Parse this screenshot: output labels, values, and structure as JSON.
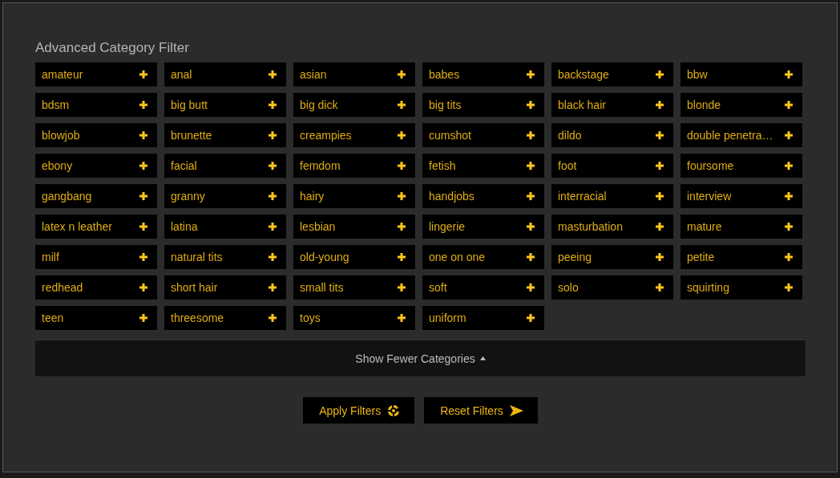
{
  "title": "Advanced Category Filter",
  "categories": [
    "amateur",
    "anal",
    "asian",
    "babes",
    "backstage",
    "bbw",
    "bdsm",
    "big butt",
    "big dick",
    "big tits",
    "black hair",
    "blonde",
    "blowjob",
    "brunette",
    "creampies",
    "cumshot",
    "dildo",
    "double penetra…",
    "ebony",
    "facial",
    "femdom",
    "fetish",
    "foot",
    "foursome",
    "gangbang",
    "granny",
    "hairy",
    "handjobs",
    "interracial",
    "interview",
    "latex n leather",
    "latina",
    "lesbian",
    "lingerie",
    "masturbation",
    "mature",
    "milf",
    "natural tits",
    "old-young",
    "one on one",
    "peeing",
    "petite",
    "redhead",
    "short hair",
    "small tits",
    "soft",
    "solo",
    "squirting",
    "teen",
    "threesome",
    "toys",
    "uniform"
  ],
  "toggle": {
    "label": "Show Fewer Categories",
    "expanded": true
  },
  "buttons": [
    {
      "label": "Apply Filters",
      "kind": "apply"
    },
    {
      "label": "Reset Filters",
      "kind": "reset"
    }
  ]
}
